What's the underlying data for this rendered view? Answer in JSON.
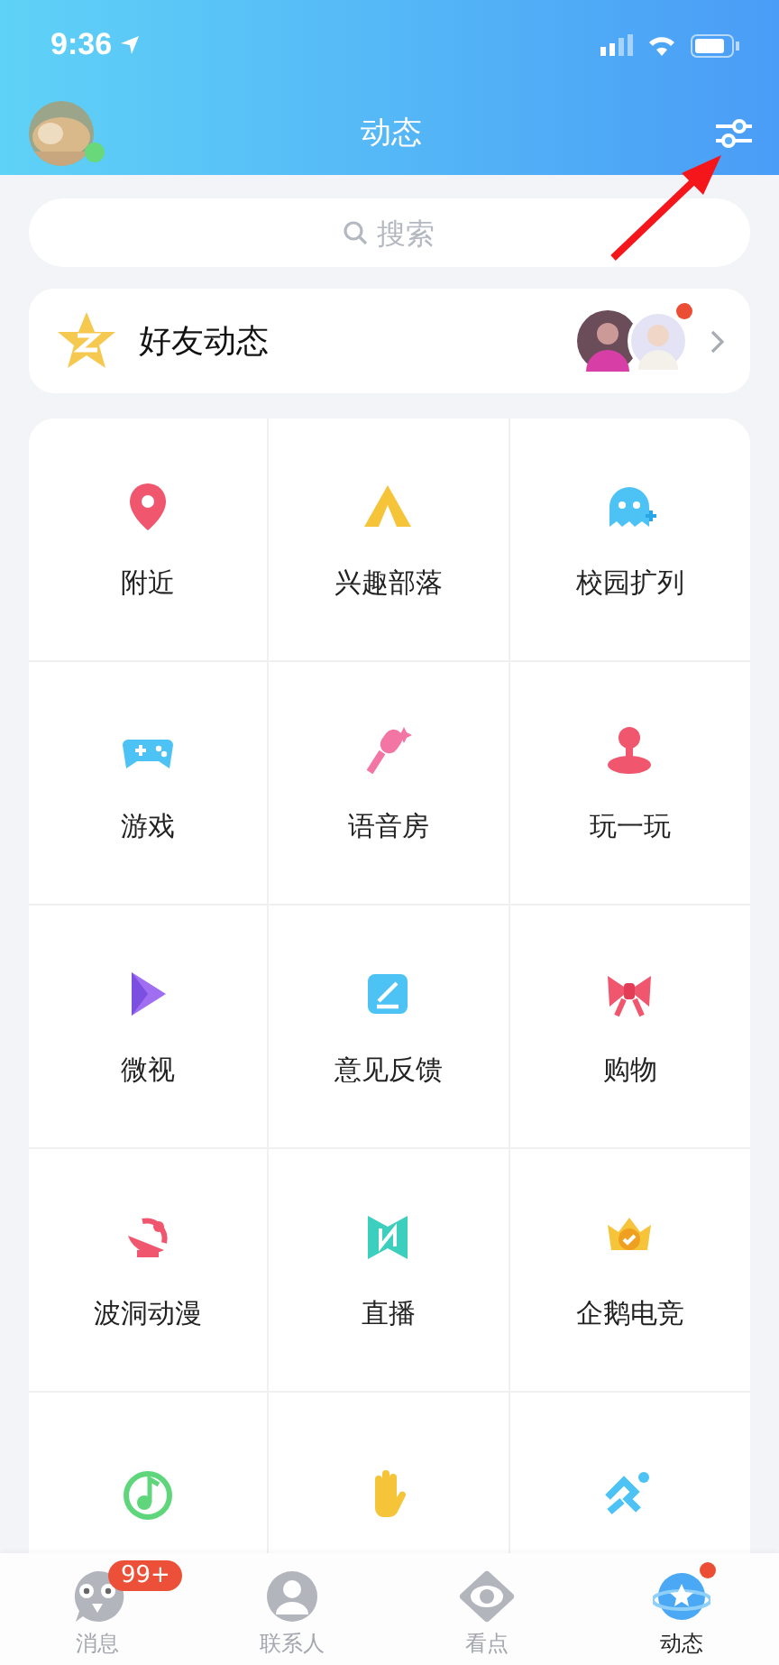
{
  "status_bar": {
    "time": "9:36"
  },
  "header": {
    "title": "动态",
    "online": true
  },
  "search": {
    "placeholder": "搜索"
  },
  "friends_feed": {
    "label": "好友动态",
    "unread": true
  },
  "grid": {
    "items": [
      {
        "kind": "labeled",
        "label": "附近"
      },
      {
        "kind": "labeled",
        "label": "兴趣部落"
      },
      {
        "kind": "labeled",
        "label": "校园扩列"
      },
      {
        "kind": "labeled",
        "label": "游戏"
      },
      {
        "kind": "labeled",
        "label": "语音房"
      },
      {
        "kind": "labeled",
        "label": "玩一玩"
      },
      {
        "kind": "labeled",
        "label": "微视"
      },
      {
        "kind": "labeled",
        "label": "意见反馈"
      },
      {
        "kind": "labeled",
        "label": "购物"
      },
      {
        "kind": "labeled",
        "label": "波洞动漫"
      },
      {
        "kind": "labeled",
        "label": "直播"
      },
      {
        "kind": "labeled",
        "label": "企鹅电竞"
      },
      {
        "kind": "covered"
      },
      {
        "kind": "covered"
      },
      {
        "kind": "covered"
      }
    ]
  },
  "tabs": [
    {
      "label": "消息",
      "badge": "99+",
      "dot": false,
      "selected": false
    },
    {
      "label": "联系人",
      "dot": false,
      "selected": false
    },
    {
      "label": "看点",
      "dot": false,
      "selected": false
    },
    {
      "label": "动态",
      "dot": true,
      "selected": true
    }
  ]
}
